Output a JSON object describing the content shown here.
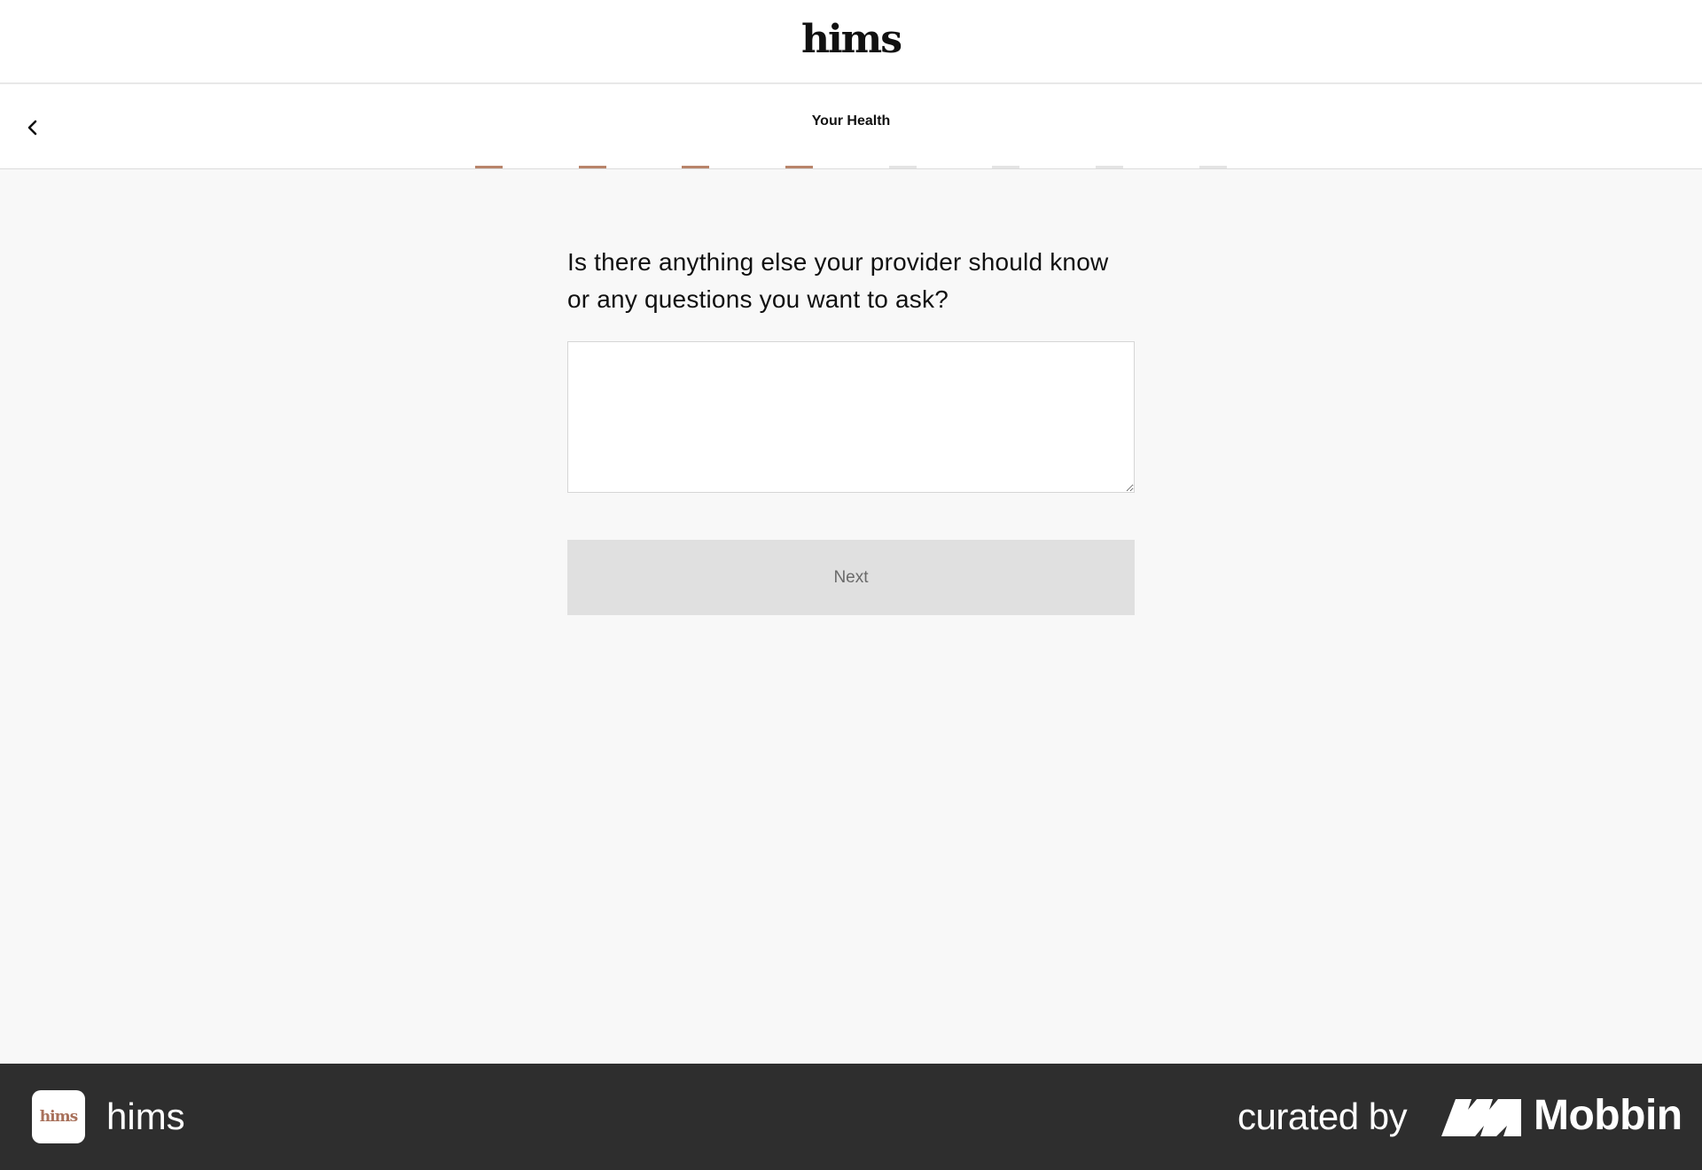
{
  "header": {
    "brand": "hims"
  },
  "nav": {
    "back_icon": "chevron-left-icon",
    "section_title": "Your Health"
  },
  "progress": {
    "total_steps": 8,
    "completed_steps": 4,
    "active_color": "#b8846a",
    "inactive_color": "#e4e4e4"
  },
  "question": {
    "text": "Is there anything else your provider should know or any questions you want to ask?"
  },
  "answer_field": {
    "value": "",
    "placeholder": ""
  },
  "next_button": {
    "label": "Next",
    "disabled": true
  },
  "footer": {
    "app_icon_text": "hims",
    "app_name": "hims",
    "curated_by": "curated by",
    "mobbin_name": "Mobbin",
    "background": "#2e2e2e"
  }
}
